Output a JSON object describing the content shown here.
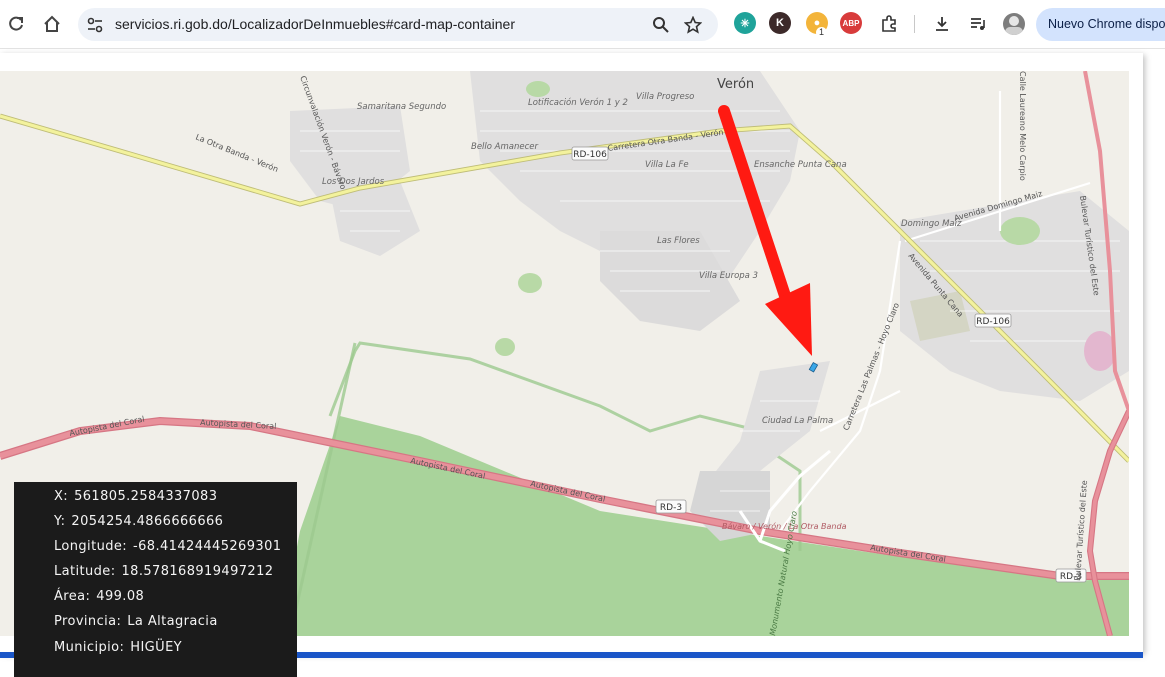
{
  "browser": {
    "url": "servicios.ri.gob.do/LocalizadorDeInmuebles#card-map-container",
    "chrome_pill": "Nuevo Chrome disponible",
    "extensions": [
      {
        "name": "perplexity-icon",
        "color": "#1fa39a",
        "glyph": "✳"
      },
      {
        "name": "k-extension-icon",
        "color": "#3d2a2a",
        "glyph": "K"
      },
      {
        "name": "cookie-extension-icon",
        "color": "#f3b43a",
        "glyph": "●",
        "badge": "1"
      },
      {
        "name": "adblock-plus-icon",
        "color": "#d83b3b",
        "glyph": "ABP"
      }
    ]
  },
  "map": {
    "places": {
      "veron": "Verón",
      "villa_progreso": "Villa Progreso",
      "lotificacion": "Lotificación Verón 1 y 2",
      "samaritana": "Samaritana Segundo",
      "bello_amanecer": "Bello Amanecer",
      "los_dos_jardos": "Los Dos Jardos",
      "villa_la_fe": "Villa La Fe",
      "ensanche": "Ensanche Punta Cana",
      "las_flores": "Las Flores",
      "villa_europa": "Villa Europa 3",
      "domingo_maiz": "Domingo Maiz",
      "ciudad_la_palma": "Ciudad La Palma"
    },
    "roads": {
      "rd106_shield": "RD-106",
      "rd3_shield": "RD-3",
      "carretera_otra_banda": "Carretera Otra Banda - Verón",
      "la_otra_banda": "La Otra Banda - Verón",
      "circunvalacion": "Circunvalación Verón - Bávaro",
      "autopista_coral": "Autopista del Coral",
      "avenida_domingo_maiz": "Avenida Domingo Maiz",
      "avenida_punta_cana": "Avenida Punta Cana",
      "carretera_las_palmas": "Carretera Las Palmas - Hoyo Claro",
      "bavaro_otra_banda": "Bávaro / Verón / La Otra Banda",
      "boulevard_turistico": "Bulevar Turístico del Este",
      "calle_laureano": "Calle Laureano Melo Carpio",
      "hoyo_claro": "Monumento Natural Hoyo Claro"
    },
    "colors": {
      "land": "#f1efe9",
      "residential": "#e0dfdf",
      "forest": "#a9d39b",
      "highway": "#e58b95",
      "primary": "#f3f29d",
      "arrow": "#ff1a12"
    }
  },
  "info": {
    "x_label": "X:",
    "x_value": "561805.2584337083",
    "y_label": "Y:",
    "y_value": "2054254.4866666666",
    "lon_label": "Longitude:",
    "lon_value": "-68.41424445269301",
    "lat_label": "Latitude:",
    "lat_value": "18.578168919497212",
    "area_label": "Área:",
    "area_value": "499.08",
    "prov_label": "Provincia:",
    "prov_value": "La Altagracia",
    "mun_label": "Municipio:",
    "mun_value": "HIGÜEY"
  }
}
